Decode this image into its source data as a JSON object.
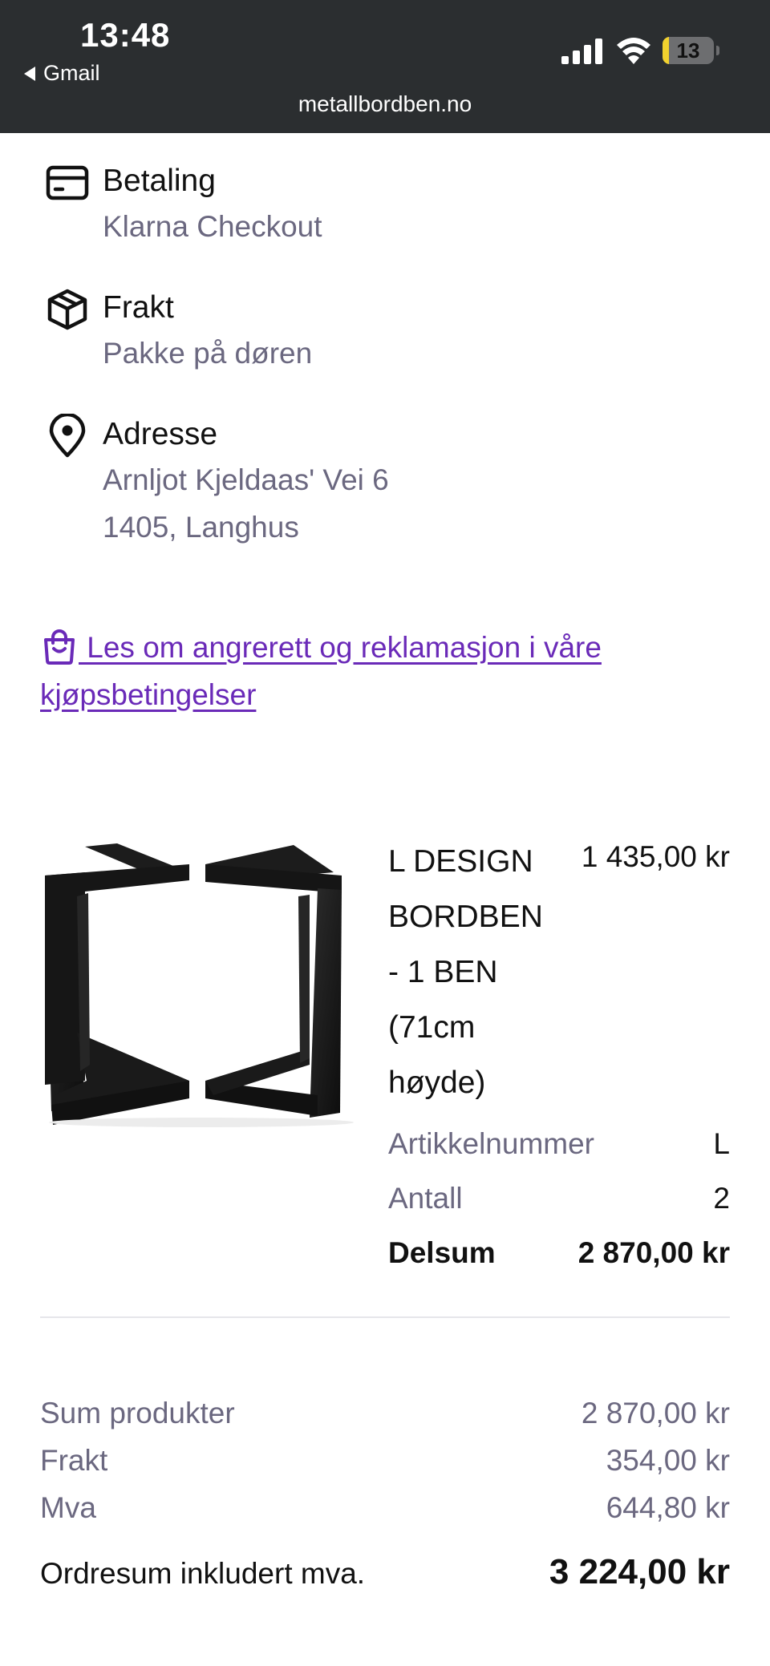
{
  "status_bar": {
    "time": "13:48",
    "back_label": "Gmail",
    "battery_level": "13",
    "url": "metallbordben.no"
  },
  "sections": {
    "payment": {
      "title": "Betaling",
      "value": "Klarna Checkout",
      "icon": "credit-card-icon"
    },
    "shipping": {
      "title": "Frakt",
      "value": "Pakke på døren",
      "icon": "package-icon"
    },
    "address": {
      "title": "Adresse",
      "line1": "Arnljot Kjeldaas' Vei 6",
      "line2": "1405, Langhus",
      "icon": "map-pin-icon"
    }
  },
  "terms_link": {
    "text": " Les om angrerett og reklamasjon i våre kjøpsbetingelser",
    "icon": "shopping-bag-icon"
  },
  "product": {
    "name_lines": [
      "L DESIGN",
      "BORDBEN",
      "- 1 BEN",
      "(71cm",
      "høyde)"
    ],
    "price": "1 435,00 kr",
    "sku_label": "Artikkelnummer",
    "sku_value": "L",
    "qty_label": "Antall",
    "qty_value": "2",
    "subtotal_label": "Delsum",
    "subtotal_value": "2 870,00 kr"
  },
  "summary": {
    "products_label": "Sum produkter",
    "products_value": "2 870,00 kr",
    "shipping_label": "Frakt",
    "shipping_value": "354,00 kr",
    "vat_label": "Mva",
    "vat_value": "644,80 kr",
    "total_label": "Ordresum inkludert mva.",
    "total_value": "3 224,00 kr"
  },
  "colors": {
    "topbar": "#2b2e30",
    "link": "#6a2ab8",
    "muted_text": "#6b6880",
    "battery": "#f2d22e"
  }
}
